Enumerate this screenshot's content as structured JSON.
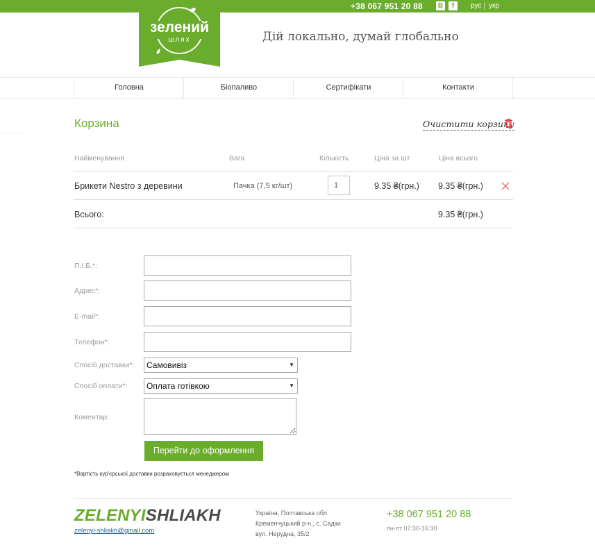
{
  "topbar": {
    "phone": "+38 067 951 20 88",
    "social": [
      "В",
      "f"
    ],
    "lang": [
      "рус",
      "укр"
    ]
  },
  "logo": {
    "line1": "зелений",
    "line2": "шлях"
  },
  "slogan": "Дій локально, думай глобально",
  "nav": [
    "Головна",
    "Біопаливо",
    "Сертифікати",
    "Контакти"
  ],
  "cart": {
    "title": "Корзина",
    "clear_label": "Очистити корзину",
    "columns": {
      "name": "Найменування",
      "weight": "Вага",
      "qty": "Кількість",
      "unit_price": "Ціна за шт",
      "total_price": "Ціна всього"
    },
    "rows": [
      {
        "name": "Брикети Nestro з деревини",
        "weight": "Пачка (7,5 кг/шт)",
        "qty": "1",
        "unit_price": "9.35 ₴(грн.)",
        "total_price": "9.35 ₴(грн.)"
      }
    ],
    "total_label": "Всього:",
    "total_value": "9.35 ₴(грн.)"
  },
  "form": {
    "fio_label": "П.І.Б.*:",
    "address_label": "Адрес*:",
    "email_label": "E-mail*:",
    "phone_label": "Телефон*:",
    "delivery_label": "Спосіб доставки*:",
    "delivery_value": "Самовивіз",
    "payment_label": "Спосіб оплати*:",
    "payment_value": "Оплата готівкою",
    "comment_label": "Коментар:",
    "submit_label": "Перейти до оформлення",
    "note": "*Вартість кур'єрської доставки розраховується менеджером"
  },
  "footer": {
    "brand_green": "ZELENYI",
    "brand_dark": "SHLIAKH",
    "email": "zelenyi-shliakh@gmail.com",
    "address": [
      "Україна, Полтавська обл.",
      "Кременчуцький р-н., с. Садки",
      "вул. Нерудна, 35/2"
    ],
    "phone": "+38 067 951 20 88",
    "hours": "пн-пт 07:30-16:30"
  },
  "colors": {
    "accent": "#6aad2c",
    "remove": "#e05050",
    "link": "#2a63a5"
  },
  "icons": [
    "trash-icon",
    "close-icon",
    "chevron-down-icon",
    "leaf-icon",
    "vk-icon",
    "facebook-icon"
  ]
}
